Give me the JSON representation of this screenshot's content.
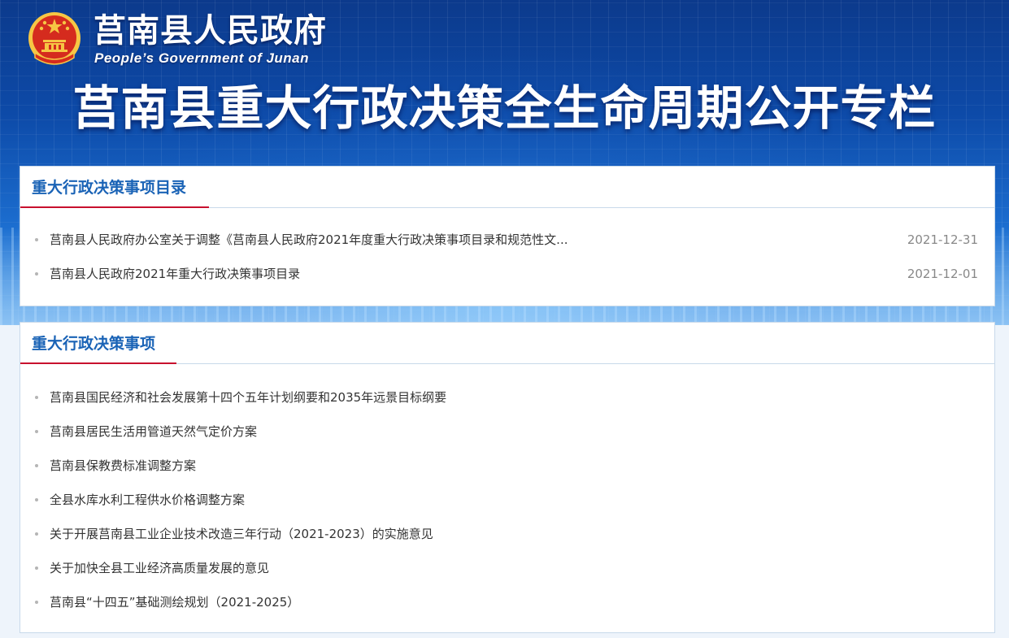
{
  "header": {
    "gov_name": "莒南县人民政府",
    "gov_name_en": "People’s Government of Junan",
    "headline": "莒南县重大行政决策全生命周期公开专栏",
    "emblem_icon": "national-emblem-icon"
  },
  "sections": [
    {
      "title": "重大行政决策事项目录",
      "items": [
        {
          "text": "莒南县人民政府办公室关于调整《莒南县人民政府2021年度重大行政决策事项目录和规范性文...",
          "date": "2021-12-31"
        },
        {
          "text": "莒南县人民政府2021年重大行政决策事项目录",
          "date": "2021-12-01"
        }
      ]
    },
    {
      "title": "重大行政决策事项",
      "items": [
        {
          "text": "莒南县国民经济和社会发展第十四个五年计划纲要和2035年远景目标纲要"
        },
        {
          "text": "莒南县居民生活用管道天然气定价方案"
        },
        {
          "text": "莒南县保教费标准调整方案"
        },
        {
          "text": "全县水库水利工程供水价格调整方案"
        },
        {
          "text": "关于开展莒南县工业企业技术改造三年行动（2021-2023）的实施意见"
        },
        {
          "text": "关于加快全县工业经济高质量发展的意见"
        },
        {
          "text": "莒南县“十四五”基础测绘规划（2021-2025）"
        }
      ]
    }
  ],
  "colors": {
    "accent_blue": "#1a63b6",
    "accent_red": "#c8102e",
    "banner_blue": "#0d4aa8",
    "emblem_red": "#d52b1e",
    "emblem_gold": "#f6c644"
  }
}
